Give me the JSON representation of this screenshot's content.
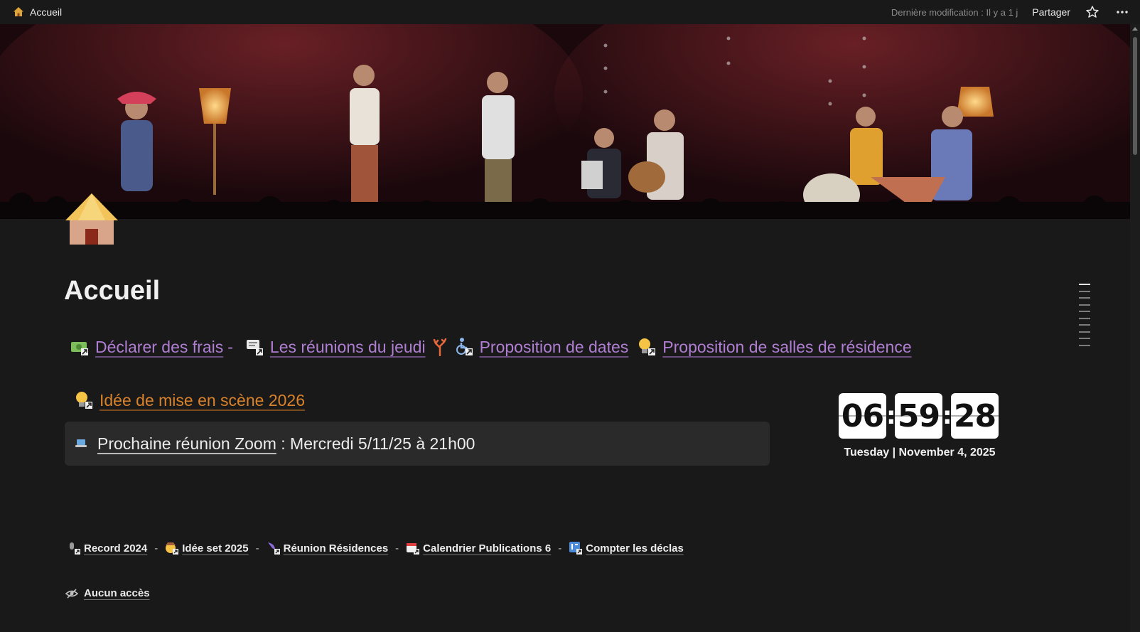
{
  "topbar": {
    "breadcrumb": "Accueil",
    "last_modified": "Dernière modification : Il y a 1 j",
    "share_label": "Partager"
  },
  "page": {
    "title": "Accueil"
  },
  "links_row": {
    "items": [
      {
        "label": "Déclarer des frais",
        "icon": "money-icon"
      },
      {
        "label": "Les réunions du jeudi",
        "icon": "chat-icon"
      },
      {
        "label": "Proposition de dates",
        "icon": "wheelchair-icon"
      },
      {
        "label": "Proposition de salles de résidence",
        "icon": "bulb-icon"
      }
    ],
    "separator": "-"
  },
  "idea_link": {
    "label": "Idée de mise en scène 2026"
  },
  "callout": {
    "link_label": "Prochaine réunion Zoom",
    "text": " : Mercredi 5/11/25 à 21h00"
  },
  "clock": {
    "hours": "06",
    "minutes": "59",
    "seconds": "28",
    "date": "Tuesday | November 4, 2025"
  },
  "bottom_links": {
    "items": [
      {
        "label": "Record 2024"
      },
      {
        "label": "Idée set 2025"
      },
      {
        "label": "Réunion Résidences"
      },
      {
        "label": "Calendrier Publications 6"
      },
      {
        "label": "Compter les déclas"
      }
    ],
    "separator": "-"
  },
  "no_access": {
    "label": "Aucun accès"
  },
  "colors": {
    "background": "#191919",
    "link_purple": "#b07ed3",
    "link_orange": "#d9822b",
    "callout_bg": "#2a2a2a"
  }
}
